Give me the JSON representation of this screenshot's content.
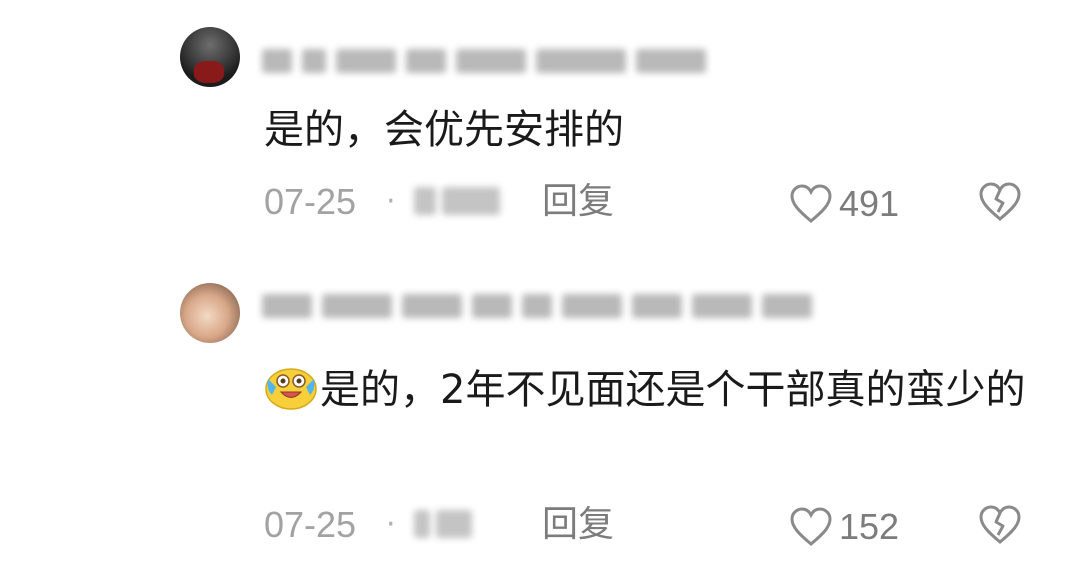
{
  "comments": [
    {
      "text": "是的，会优先安排的",
      "date": "07-25",
      "separator": "·",
      "reply_label": "回复",
      "like_count": "491",
      "avatar_icon": "user-avatar-icon",
      "like_icon": "heart-outline-icon",
      "dislike_icon": "broken-heart-icon"
    },
    {
      "emoji": "crying-laughing-emoji",
      "text": "是的，2年不见面还是个干部真的蛮少的",
      "date": "07-25",
      "separator": "·",
      "reply_label": "回复",
      "like_count": "152",
      "avatar_icon": "user-avatar-icon",
      "like_icon": "heart-outline-icon",
      "dislike_icon": "broken-heart-icon"
    }
  ],
  "colors": {
    "text": "#1a1a1a",
    "meta": "#a2a2a2",
    "reply": "#7c7c7c",
    "icon": "#8a8a8a"
  }
}
